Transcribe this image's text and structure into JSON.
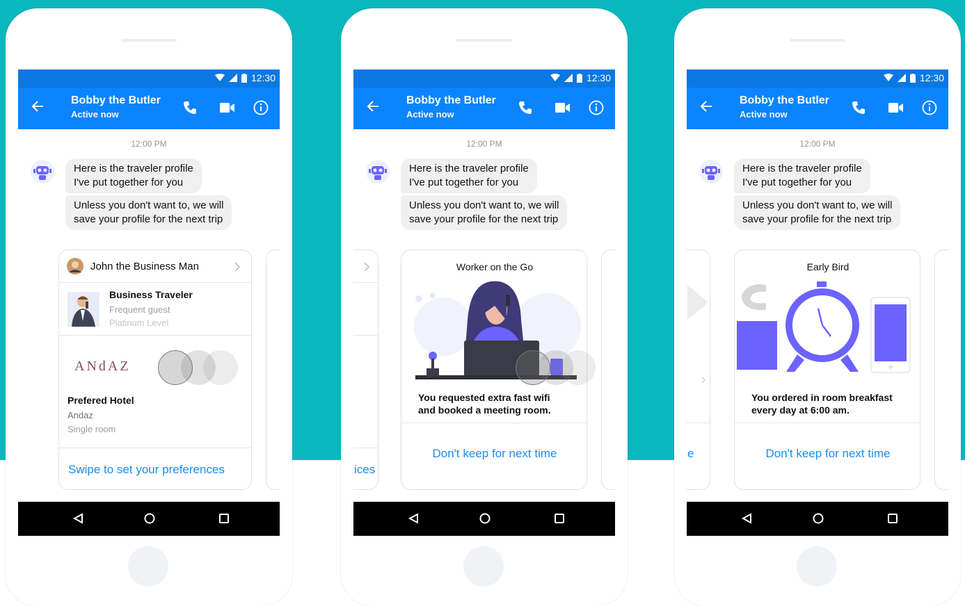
{
  "status": {
    "time": "12:30"
  },
  "chat": {
    "contact_name": "Bobby the Butler",
    "presence": "Active now",
    "timestamp": "12:00 PM",
    "message_1_line1": "Here is the traveler profile",
    "message_1_line2": "I've put together for you",
    "message_2_line1": "Unless you don't want to, we will",
    "message_2_line2": "save your profile for the next trip"
  },
  "screen1": {
    "profile_name": "John the Business Man",
    "traveler_type": "Business Traveler",
    "guest_status": "Frequent guest",
    "level": "Platinum Level",
    "hotel_logo": "ANdAZ",
    "hotel_heading": "Prefered Hotel",
    "hotel_name": "Andaz",
    "room": "Single room",
    "cta": "Swipe to set your preferences"
  },
  "screen2": {
    "card_title": "Worker on the Go",
    "description_line1": "You requested extra fast wifi",
    "description_line2": "and booked a meeting room.",
    "cta": "Don't keep for next time",
    "prev_card_fragment": "ices"
  },
  "screen3": {
    "card_title": "Early Bird",
    "description_line1": "You ordered in room breakfast",
    "description_line2": "every day at 6:00 am.",
    "cta": "Don't keep for next time",
    "prev_card_fragment": "e"
  },
  "icons": {
    "back": "arrow-left-icon",
    "call": "phone-icon",
    "video": "video-icon",
    "info": "info-icon",
    "nav_back": "triangle-back-icon",
    "nav_home": "circle-home-icon",
    "nav_recent": "square-recent-icon"
  },
  "colors": {
    "accent": "#0b84ff",
    "background": "#0bb7bf",
    "link": "#1a8cf2",
    "illustration": "#6c63ff"
  }
}
